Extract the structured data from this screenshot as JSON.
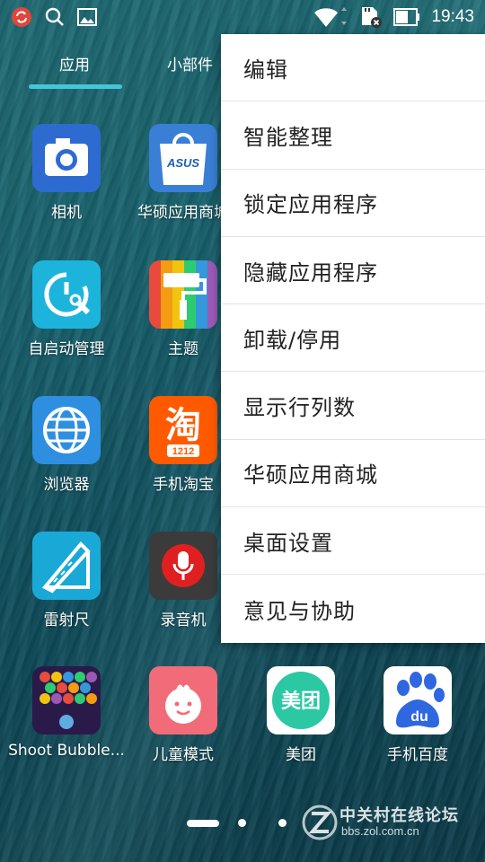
{
  "status_bar": {
    "time": "19:43",
    "icons": [
      "sync-icon",
      "search-icon",
      "image-icon",
      "wifi-icon",
      "sd-card-icon",
      "battery-icon"
    ]
  },
  "tabs": [
    {
      "label": "应用",
      "active": true
    },
    {
      "label": "小部件",
      "active": false
    }
  ],
  "apps": [
    {
      "label": "相机",
      "icon": "camera-icon"
    },
    {
      "label": "华硕应用商城",
      "icon": "asus-store-icon"
    },
    {
      "label": "自启动管理",
      "icon": "autostart-icon"
    },
    {
      "label": "主题",
      "icon": "theme-icon"
    },
    {
      "label": "浏览器",
      "icon": "browser-icon"
    },
    {
      "label": "手机淘宝",
      "icon": "taobao-icon"
    },
    {
      "label": "雷射尺",
      "icon": "laser-ruler-icon"
    },
    {
      "label": "录音机",
      "icon": "recorder-icon"
    },
    {
      "label": "Shoot Bubble...",
      "icon": "bubble-game-icon"
    },
    {
      "label": "儿童模式",
      "icon": "kids-mode-icon"
    },
    {
      "label": "美团",
      "icon": "meituan-icon"
    },
    {
      "label": "手机百度",
      "icon": "baidu-icon"
    }
  ],
  "asus_logo_text": "ASUS",
  "taobao_char": "淘",
  "taobao_badge": "1212",
  "meituan_text": "美团",
  "baidu_text": "du",
  "menu": {
    "items": [
      "编辑",
      "智能整理",
      "锁定应用程序",
      "隐藏应用程序",
      "卸载/停用",
      "显示行列数",
      "华硕应用商城",
      "桌面设置",
      "意见与协助"
    ]
  },
  "watermark": {
    "title": "中关村在线论坛",
    "url": "bbs.zol.com.cn"
  },
  "colors": {
    "tab_indicator": "#42c7d8",
    "menu_bg": "#ffffff"
  }
}
